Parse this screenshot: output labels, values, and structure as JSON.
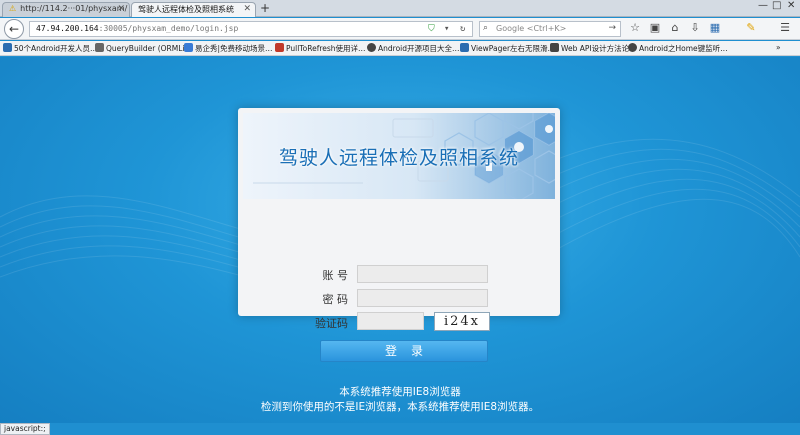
{
  "browser": {
    "tabs": [
      {
        "label": "http://114.2···01/physxam/",
        "active": false
      },
      {
        "label": "驾驶人远程体检及照相系统",
        "active": true
      }
    ],
    "new_tab_label": "+",
    "window_controls": {
      "minimize": "—",
      "maximize": "□",
      "close": "✕"
    },
    "url": {
      "host": "47.94.200.164",
      "path": ":30005/physxam_demo/login.jsp"
    },
    "search": {
      "placeholder": "Google <Ctrl+K>"
    },
    "bookmarks": [
      {
        "label": "50个Android开发人员…",
        "color": "#2b6cb0"
      },
      {
        "label": "QueryBuilder (ORMLi…",
        "color": "#666666"
      },
      {
        "label": "易企秀|免费移动场景…",
        "color": "#3a7bd5"
      },
      {
        "label": "PullToRefresh使用详…",
        "color": "#c0392b"
      },
      {
        "label": "Android开源项目大全…",
        "color": "#444444"
      },
      {
        "label": "ViewPager左右无限滑…",
        "color": "#2b6cb0"
      },
      {
        "label": "Web API设计方法论",
        "color": "#444444"
      },
      {
        "label": "Android之Home键监听…",
        "color": "#444444"
      }
    ],
    "status_text": "javascript:;"
  },
  "login": {
    "banner_title": "驾驶人远程体检及照相系统",
    "account_label": "账  号",
    "password_label": "密  码",
    "captcha_label": "验证码",
    "captcha_value": "i24x",
    "submit_label": "登录"
  },
  "notices": {
    "line1": "本系统推荐使用IE8浏览器",
    "line2": "检测到你使用的不是IE浏览器，本系统推荐使用IE8浏览器。"
  },
  "colors": {
    "page_background": "#1f95d6",
    "button": "#2a94dd",
    "banner_title": "#1a6fb6"
  }
}
